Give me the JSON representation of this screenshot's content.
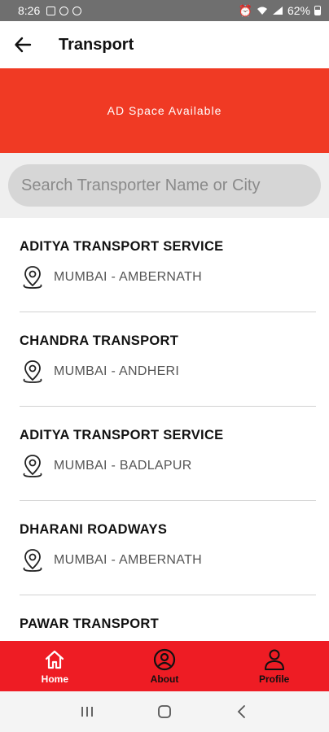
{
  "status_bar": {
    "time": "8:26",
    "battery": "62%"
  },
  "header": {
    "title": "Transport",
    "back_icon": "arrow-left-icon"
  },
  "ad": {
    "text": "AD Space Available"
  },
  "search": {
    "placeholder": "Search Transporter Name or City",
    "value": ""
  },
  "transporters": [
    {
      "name": "ADITYA TRANSPORT SERVICE",
      "location": "MUMBAI - AMBERNATH"
    },
    {
      "name": "CHANDRA TRANSPORT",
      "location": "MUMBAI - ANDHERI"
    },
    {
      "name": "ADITYA TRANSPORT SERVICE",
      "location": "MUMBAI - BADLAPUR"
    },
    {
      "name": "DHARANI ROADWAYS",
      "location": "MUMBAI - AMBERNATH"
    },
    {
      "name": "PAWAR TRANSPORT",
      "location": ""
    }
  ],
  "bottom_nav": {
    "items": [
      {
        "label": "Home",
        "icon": "home-icon"
      },
      {
        "label": "About",
        "icon": "user-circle-icon"
      },
      {
        "label": "Profile",
        "icon": "person-icon"
      }
    ]
  },
  "colors": {
    "brand_red": "#ee1c24",
    "ad_red": "#f03a24"
  }
}
